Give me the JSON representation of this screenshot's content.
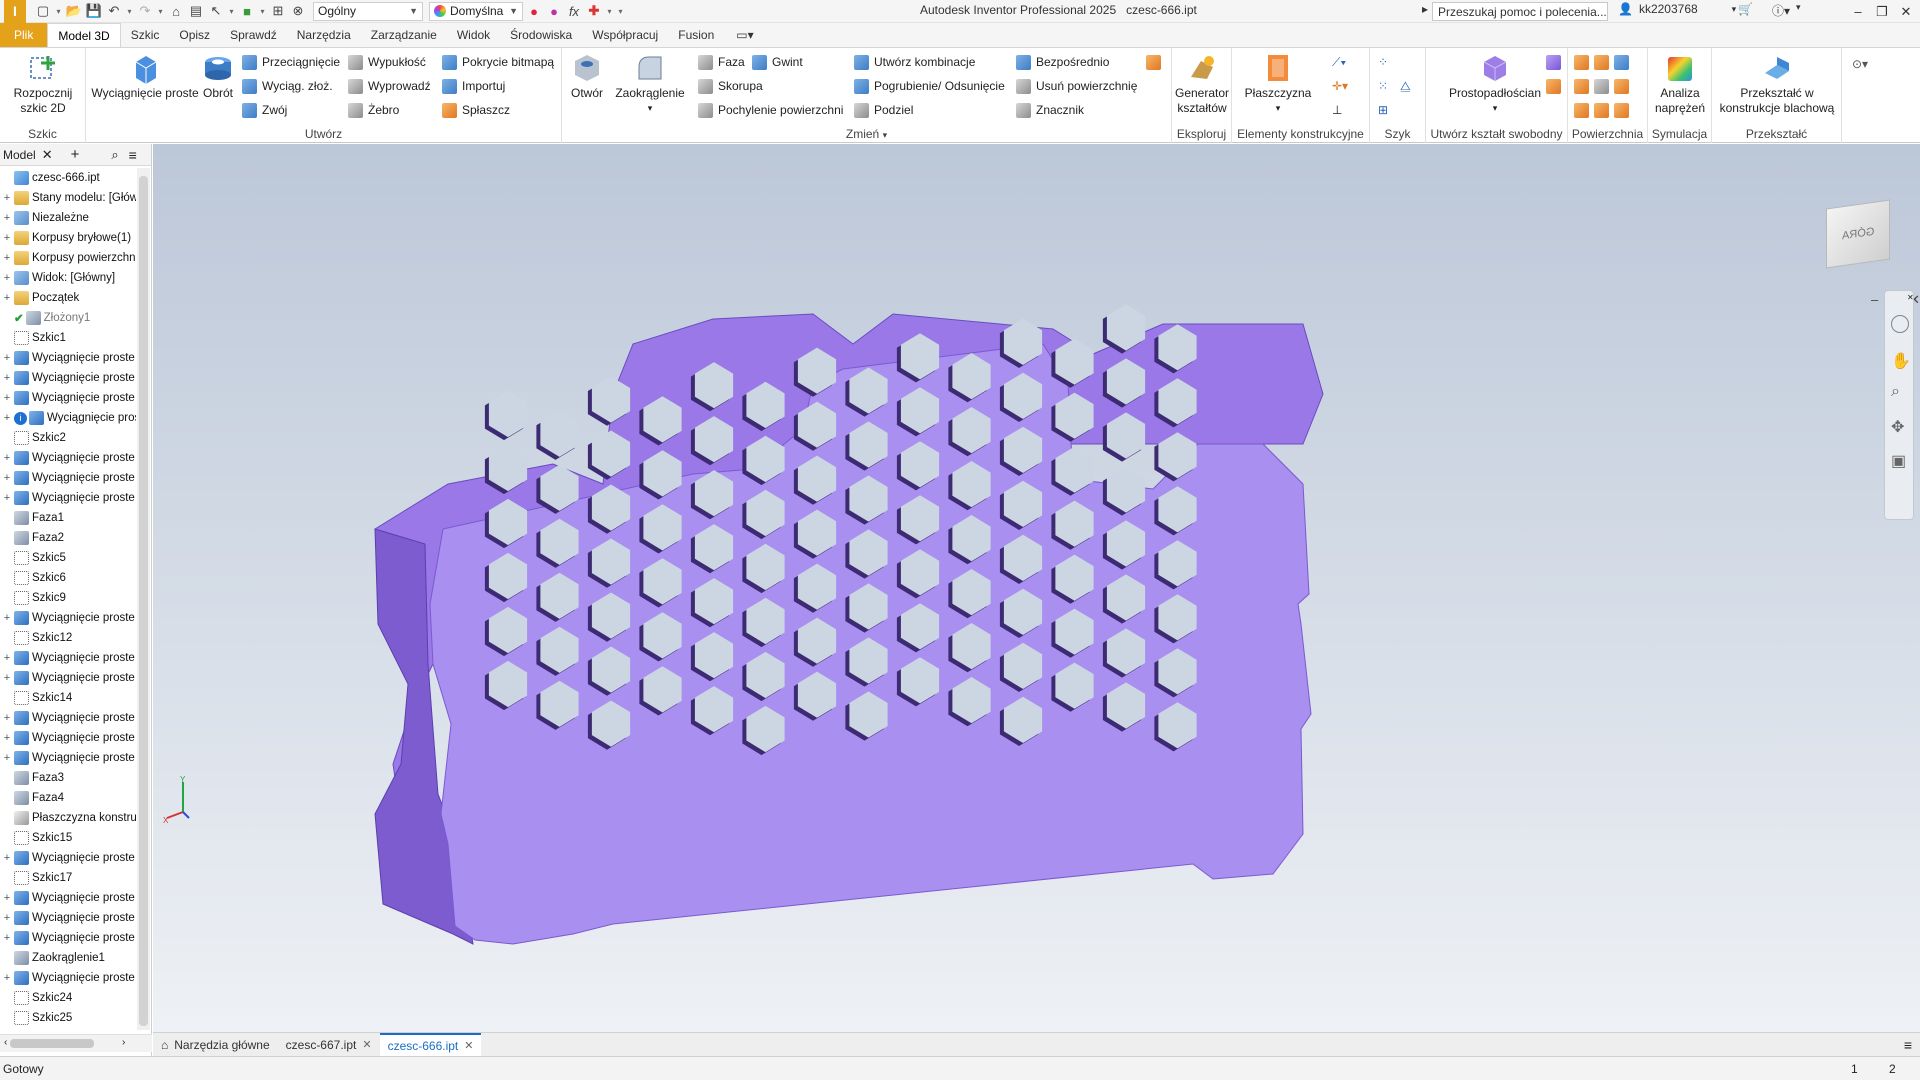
{
  "app": {
    "title": "Autodesk Inventor Professional 2025",
    "file": "czesc-666.ipt",
    "logo_letter": "I"
  },
  "quick_access": {
    "appearance_select": "Ogólny",
    "material_select": "Domyślna"
  },
  "search": {
    "placeholder": "Przeszukaj pomoc i polecenia..."
  },
  "user": {
    "name": "kk2203768"
  },
  "window_controls": {
    "minimize": "–",
    "restore": "❐",
    "close": "✕"
  },
  "ribbon_tabs": [
    "Plik",
    "Model 3D",
    "Szkic",
    "Opisz",
    "Sprawdź",
    "Narzędzia",
    "Zarządzanie",
    "Widok",
    "Środowiska",
    "Współpracuj",
    "Fusion"
  ],
  "ribbon_active_tab": "Model 3D",
  "ribbon": {
    "szkic": {
      "title": "Szkic",
      "start_sketch": "Rozpocznij szkic 2D"
    },
    "utworz": {
      "title": "Utwórz",
      "extrude": "Wyciągnięcie proste",
      "revolve": "Obrót",
      "sweep": "Przeciągnięcie",
      "loft": "Wyciąg. złoż.",
      "coil": "Zwój",
      "emboss": "Wypukłość",
      "derive": "Wyprowadź",
      "rib": "Żebro",
      "decal": "Pokrycie bitmapą",
      "import": "Importuj",
      "unwrap": "Spłaszcz"
    },
    "zmien": {
      "title": "Zmień",
      "hole": "Otwór",
      "fillet": "Zaokrąglenie",
      "chamfer": "Faza",
      "thread": "Gwint",
      "shell": "Skorupa",
      "draft": "Pochylenie powierzchni",
      "combine": "Utwórz kombinacje",
      "thicken": "Pogrubienie/ Odsunięcie",
      "split": "Podziel",
      "direct": "Bezpośrednio",
      "delete_face": "Usuń powierzchnię",
      "marker": "Znacznik"
    },
    "eksploruj": {
      "title": "Eksploruj",
      "shape_generator": "Generator kształtów"
    },
    "elementy": {
      "title": "Elementy konstrukcyjne",
      "plane": "Płaszczyzna"
    },
    "szyk": {
      "title": "Szyk"
    },
    "freeform": {
      "title": "Utwórz kształt swobodny",
      "box": "Prostopadłościan"
    },
    "powierzchnia": {
      "title": "Powierzchnia"
    },
    "symulacja": {
      "title": "Symulacja",
      "stress": "Analiza naprężeń"
    },
    "przeksztalc": {
      "title": "Przekształć",
      "sheetmetal": "Przekształć w konstrukcje blachową"
    }
  },
  "browser": {
    "tab_label": "Model",
    "tree": [
      {
        "label": "czesc-666.ipt",
        "icon": "part-icon",
        "expander": ""
      },
      {
        "label": "Stany modelu: [Główny]",
        "icon": "folder-icon",
        "expander": "+"
      },
      {
        "label": "Niezależne",
        "icon": "view-icon",
        "expander": "+"
      },
      {
        "label": "Korpusy bryłowe(1)",
        "icon": "folder-icon",
        "expander": "+"
      },
      {
        "label": "Korpusy powierzchni",
        "icon": "folder-icon",
        "expander": "+"
      },
      {
        "label": "Widok: [Główny]",
        "icon": "view-icon",
        "expander": "+"
      },
      {
        "label": "Początek",
        "icon": "folder-icon",
        "expander": "+"
      },
      {
        "label": "Złożony1",
        "icon": "check-icon",
        "expander": ""
      },
      {
        "label": "Szkic1",
        "icon": "sketch-icon",
        "expander": ""
      },
      {
        "label": "Wyciągnięcie proste",
        "icon": "extrude-icon",
        "expander": "+"
      },
      {
        "label": "Wyciągnięcie proste",
        "icon": "extrude-icon",
        "expander": "+"
      },
      {
        "label": "Wyciągnięcie proste",
        "icon": "extrude-icon",
        "expander": "+"
      },
      {
        "label": "Wyciągnięcie proste",
        "icon": "extrude-info-icon",
        "expander": "+"
      },
      {
        "label": "Szkic2",
        "icon": "sketch-icon",
        "expander": ""
      },
      {
        "label": "Wyciągnięcie proste",
        "icon": "extrude-icon",
        "expander": "+"
      },
      {
        "label": "Wyciągnięcie proste",
        "icon": "extrude-icon",
        "expander": "+"
      },
      {
        "label": "Wyciągnięcie proste",
        "icon": "extrude-icon",
        "expander": "+"
      },
      {
        "label": "Faza1",
        "icon": "chamfer-icon",
        "expander": ""
      },
      {
        "label": "Faza2",
        "icon": "chamfer-icon",
        "expander": ""
      },
      {
        "label": "Szkic5",
        "icon": "sketch-icon",
        "expander": ""
      },
      {
        "label": "Szkic6",
        "icon": "sketch-icon",
        "expander": ""
      },
      {
        "label": "Szkic9",
        "icon": "sketch-icon",
        "expander": ""
      },
      {
        "label": "Wyciągnięcie proste",
        "icon": "extrude-icon",
        "expander": "+"
      },
      {
        "label": "Szkic12",
        "icon": "sketch-icon",
        "expander": ""
      },
      {
        "label": "Wyciągnięcie proste",
        "icon": "extrude-icon",
        "expander": "+"
      },
      {
        "label": "Wyciągnięcie proste",
        "icon": "extrude-icon",
        "expander": "+"
      },
      {
        "label": "Szkic14",
        "icon": "sketch-icon",
        "expander": ""
      },
      {
        "label": "Wyciągnięcie proste",
        "icon": "extrude-icon",
        "expander": "+"
      },
      {
        "label": "Wyciągnięcie proste",
        "icon": "extrude-icon",
        "expander": "+"
      },
      {
        "label": "Wyciągnięcie proste",
        "icon": "extrude-icon",
        "expander": "+"
      },
      {
        "label": "Faza3",
        "icon": "chamfer-icon",
        "expander": ""
      },
      {
        "label": "Faza4",
        "icon": "chamfer-icon",
        "expander": ""
      },
      {
        "label": "Płaszczyzna konstrukcyjna",
        "icon": "plane-icon",
        "expander": ""
      },
      {
        "label": "Szkic15",
        "icon": "sketch-icon",
        "expander": ""
      },
      {
        "label": "Wyciągnięcie proste",
        "icon": "extrude-icon",
        "expander": "+"
      },
      {
        "label": "Szkic17",
        "icon": "sketch-icon",
        "expander": ""
      },
      {
        "label": "Wyciągnięcie proste",
        "icon": "extrude-icon",
        "expander": "+"
      },
      {
        "label": "Wyciągnięcie proste",
        "icon": "extrude-icon",
        "expander": "+"
      },
      {
        "label": "Wyciągnięcie proste",
        "icon": "extrude-icon",
        "expander": "+"
      },
      {
        "label": "Zaokrąglenie1",
        "icon": "fillet-icon",
        "expander": ""
      },
      {
        "label": "Wyciągnięcie proste",
        "icon": "extrude-icon",
        "expander": "+"
      },
      {
        "label": "Szkic24",
        "icon": "sketch-icon",
        "expander": ""
      },
      {
        "label": "Szkic25",
        "icon": "sketch-icon",
        "expander": ""
      }
    ]
  },
  "viewport": {
    "viewcube_label": "GÓRA",
    "part_color": "#a98ff0",
    "part_side_color": "#9a78e8",
    "part_dark_color": "#7d5ccf",
    "hole_color": "#ccd6e2"
  },
  "doc_tabs": [
    {
      "label": "Narzędzia główne",
      "active": false,
      "closable": false
    },
    {
      "label": "czesc-667.ipt",
      "active": false,
      "closable": true
    },
    {
      "label": "czesc-666.ipt",
      "active": true,
      "closable": true
    }
  ],
  "status": {
    "text": "Gotowy",
    "count1": "1",
    "count2": "2"
  }
}
